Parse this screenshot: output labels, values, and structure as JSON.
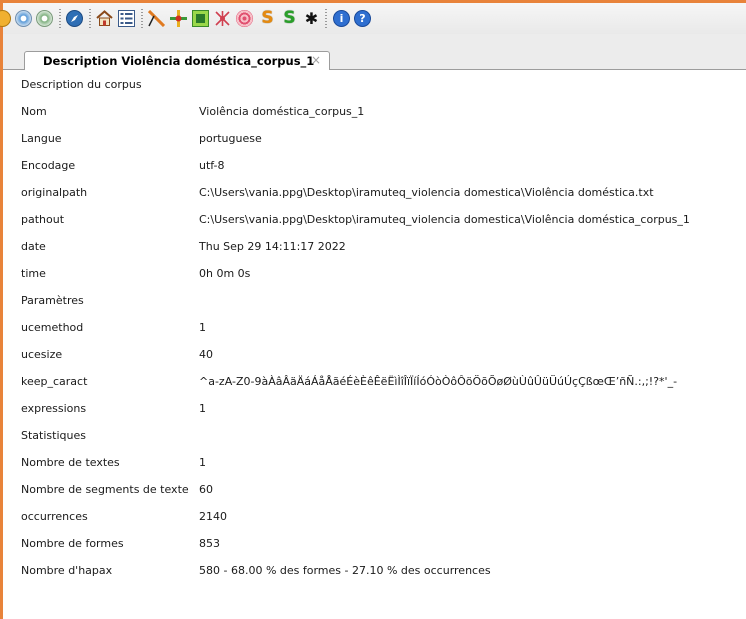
{
  "tab": {
    "title": "Description Violência doméstica_corpus_1",
    "close_glyph": "×"
  },
  "toolbar": {
    "icons": [
      "corpus-icon",
      "options-icon",
      "info-disk-icon",
      "compass-icon",
      "home-icon",
      "list-icon",
      "cut-icon",
      "cross-icon",
      "frame-icon",
      "network-icon",
      "target-icon",
      "s-icon",
      "s-green-icon",
      "star-icon",
      "info-icon",
      "help-icon"
    ],
    "s_glyph": "S",
    "star_glyph": "✱",
    "info_glyph": "i",
    "help_glyph": "?"
  },
  "colors": {
    "frame": "#e8833a",
    "tab_border": "#9c9c9c"
  },
  "rows": [
    {
      "key": "Description du corpus",
      "value": ""
    },
    {
      "key": "Nom",
      "value": "Violência doméstica_corpus_1"
    },
    {
      "key": "Langue",
      "value": "portuguese"
    },
    {
      "key": "Encodage",
      "value": "utf-8"
    },
    {
      "key": "originalpath",
      "value": "C:\\Users\\vania.ppg\\Desktop\\iramuteq_violencia domestica\\Violência doméstica.txt"
    },
    {
      "key": "pathout",
      "value": "C:\\Users\\vania.ppg\\Desktop\\iramuteq_violencia domestica\\Violência doméstica_corpus_1"
    },
    {
      "key": "date",
      "value": "Thu Sep 29 14:11:17 2022"
    },
    {
      "key": "time",
      "value": "0h 0m 0s"
    },
    {
      "key": "Paramètres",
      "value": ""
    },
    {
      "key": "ucemethod",
      "value": "1"
    },
    {
      "key": "ucesize",
      "value": "40"
    },
    {
      "key": "keep_caract",
      "value": "^a-zA-Z0-9àÀâÂäÄáÁåÅãéÉèÈêÊëËìÌîÎïÏíÍóÓòÒôÔöÖõÕøØùÙûÛüÜúÚçÇßœŒ’ñÑ.:,;!?*'_-"
    },
    {
      "key": "expressions",
      "value": "1"
    },
    {
      "key": "Statistiques",
      "value": ""
    },
    {
      "key": "Nombre de textes",
      "value": "1"
    },
    {
      "key": "Nombre de segments de texte",
      "value": "60"
    },
    {
      "key": "occurrences",
      "value": "2140"
    },
    {
      "key": "Nombre de formes",
      "value": "853"
    },
    {
      "key": "Nombre d'hapax",
      "value": "580 - 68.00 % des formes - 27.10 % des occurrences"
    }
  ]
}
